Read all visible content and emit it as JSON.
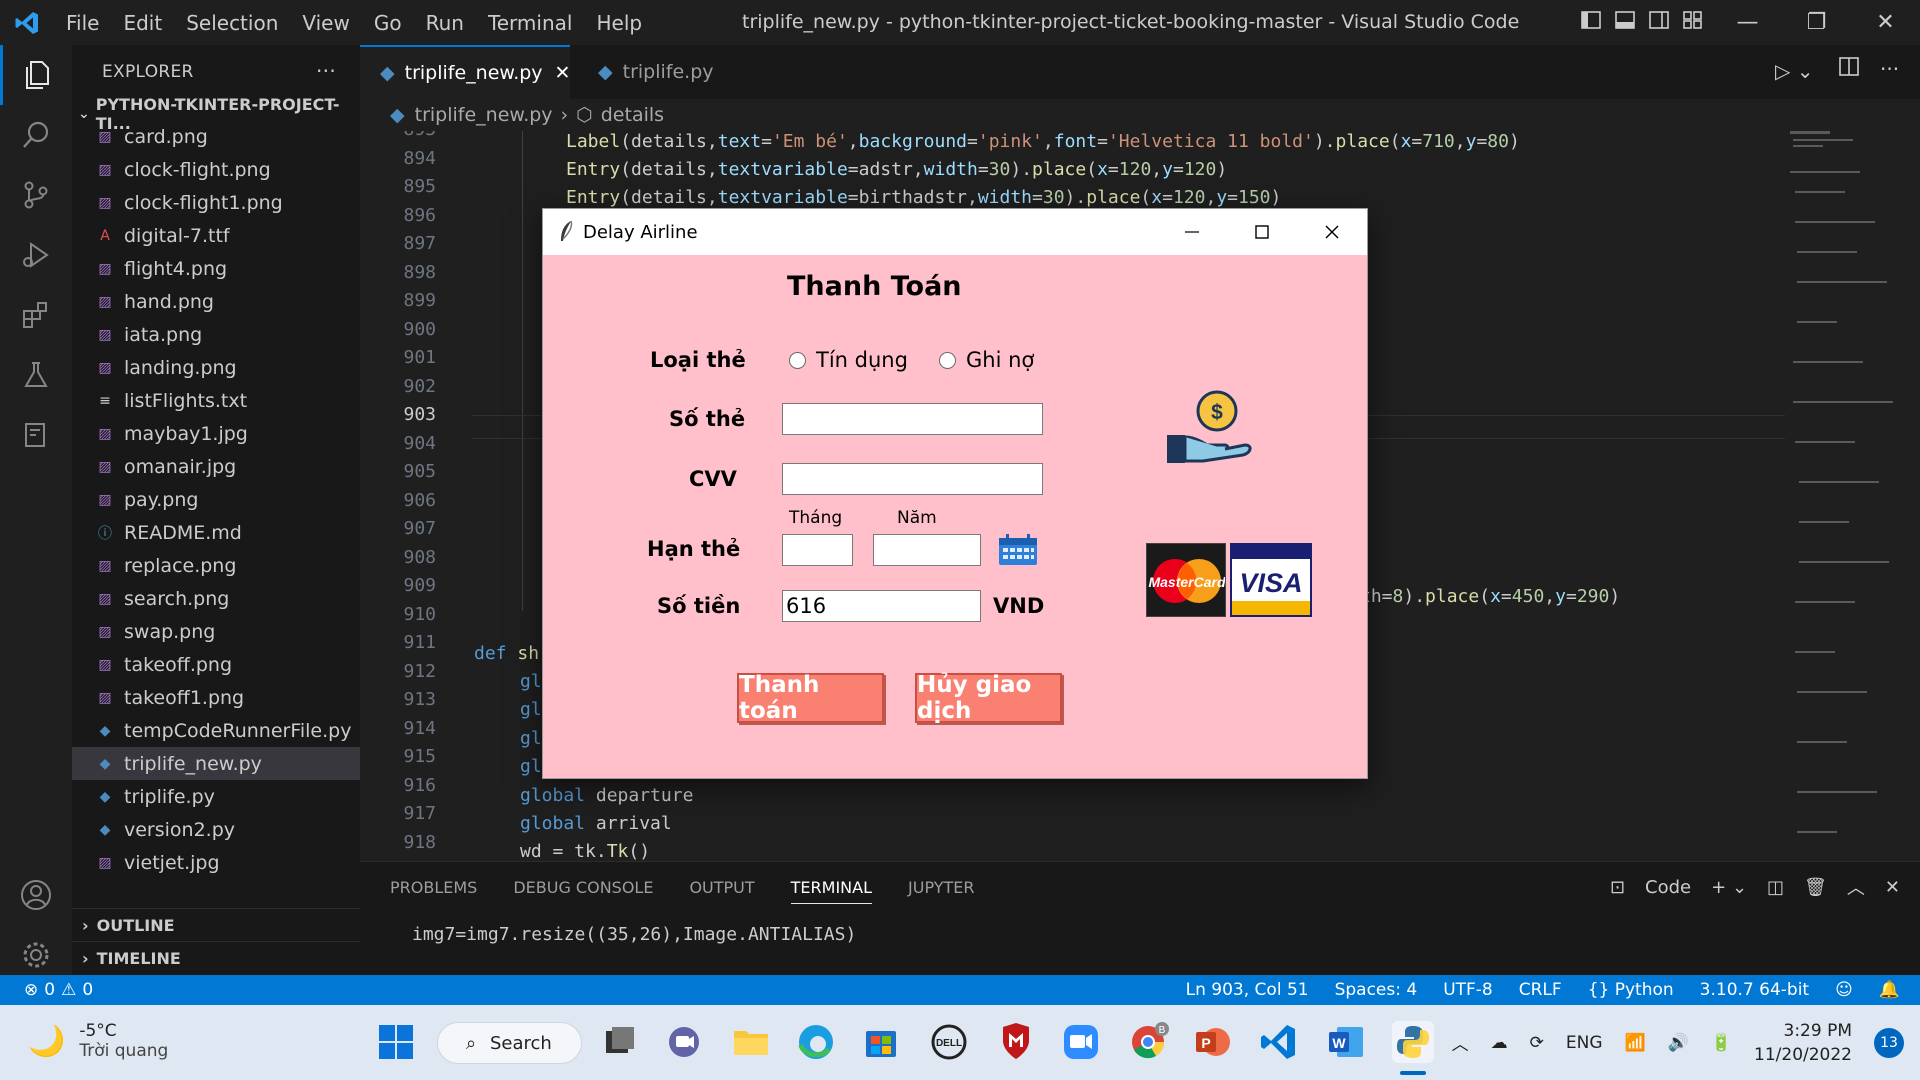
{
  "titlebar": {
    "menu": [
      "File",
      "Edit",
      "Selection",
      "View",
      "Go",
      "Run",
      "Terminal",
      "Help"
    ],
    "window_title": "triplife_new.py - python-tkinter-project-ticket-booking-master - Visual Studio Code"
  },
  "sidebar": {
    "header": "EXPLORER",
    "project": "PYTHON-TKINTER-PROJECT-TI...",
    "files": [
      {
        "name": "card.png",
        "icon": "image-file-icon"
      },
      {
        "name": "clock-flight.png",
        "icon": "image-file-icon"
      },
      {
        "name": "clock-flight1.png",
        "icon": "image-file-icon"
      },
      {
        "name": "digital-7.ttf",
        "icon": "font-file-icon"
      },
      {
        "name": "flight4.png",
        "icon": "image-file-icon"
      },
      {
        "name": "hand.png",
        "icon": "image-file-icon"
      },
      {
        "name": "iata.png",
        "icon": "image-file-icon"
      },
      {
        "name": "landing.png",
        "icon": "image-file-icon"
      },
      {
        "name": "listFlights.txt",
        "icon": "text-file-icon"
      },
      {
        "name": "maybay1.jpg",
        "icon": "image-file-icon"
      },
      {
        "name": "omanair.jpg",
        "icon": "image-file-icon"
      },
      {
        "name": "pay.png",
        "icon": "image-file-icon"
      },
      {
        "name": "README.md",
        "icon": "info-file-icon"
      },
      {
        "name": "replace.png",
        "icon": "image-file-icon"
      },
      {
        "name": "search.png",
        "icon": "image-file-icon"
      },
      {
        "name": "swap.png",
        "icon": "image-file-icon"
      },
      {
        "name": "takeoff.png",
        "icon": "image-file-icon"
      },
      {
        "name": "takeoff1.png",
        "icon": "image-file-icon"
      },
      {
        "name": "tempCodeRunnerFile.py",
        "icon": "python-file-icon"
      },
      {
        "name": "triplife_new.py",
        "icon": "python-file-icon"
      },
      {
        "name": "triplife.py",
        "icon": "python-file-icon"
      },
      {
        "name": "version2.py",
        "icon": "python-file-icon"
      },
      {
        "name": "vietjet.jpg",
        "icon": "image-file-icon"
      }
    ],
    "outline": "OUTLINE",
    "timeline": "TIMELINE"
  },
  "tabs": [
    {
      "label": "triplife_new.py",
      "active": true
    },
    {
      "label": "triplife.py",
      "active": false
    }
  ],
  "breadcrumb": {
    "file": "triplife_new.py",
    "symbol": "details"
  },
  "editor": {
    "line_numbers": [
      "893",
      "894",
      "895",
      "896",
      "897",
      "898",
      "899",
      "900",
      "901",
      "902",
      "903",
      "904",
      "905",
      "906",
      "907",
      "908",
      "909",
      "910",
      "911",
      "912",
      "913",
      "914",
      "915",
      "916",
      "917",
      "918"
    ],
    "current_line": "903",
    "lines": {
      "l893": "Label(details,text='Em bé',background='pink',font='Helvetica 11 bold').place(x=710,y=80)",
      "l894": "Entry(details,textvariable=adstr,width=30).place(x=120,y=120)",
      "l895": "Entry(details,textvariable=birthadstr,width=30).place(x=120,y=150)",
      "l909": "th=8).place(x=450,y=290)",
      "l911": "def sh",
      "l912": "gl",
      "l913": "gl",
      "l914": "gl",
      "l915": "gl",
      "l916": "global departure",
      "l917": "global arrival",
      "l918": "wd = tk.Tk()"
    }
  },
  "panel": {
    "tabs": [
      "PROBLEMS",
      "DEBUG CONSOLE",
      "OUTPUT",
      "TERMINAL",
      "JUPYTER"
    ],
    "active_tab": "TERMINAL",
    "terminal_name": "Code",
    "terminal_line": "img7=img7.resize((35,26),Image.ANTIALIAS)"
  },
  "statusbar": {
    "errors": "0",
    "warnings": "0",
    "position": "Ln 903, Col 51",
    "spaces": "Spaces: 4",
    "encoding": "UTF-8",
    "eol": "CRLF",
    "language": "Python",
    "interpreter": "3.10.7 64-bit"
  },
  "dialog": {
    "title": "Delay Airline",
    "heading": "Thanh Toán",
    "card_type_label": "Loại thẻ",
    "radio_credit": "Tín dụng",
    "radio_debit": "Ghi nợ",
    "card_number_label": "Số thẻ",
    "card_number_value": "",
    "cvv_label": "CVV",
    "cvv_value": "",
    "month_label": "Tháng",
    "year_label": "Năm",
    "expiry_label": "Hạn thẻ",
    "amount_label": "Số tiền",
    "amount_value": "616",
    "currency": "VND",
    "pay_button": "Thanh toán",
    "cancel_button": "Hủy giao dịch",
    "card_logos": {
      "mastercard": "MasterCard",
      "visa": "VISA"
    },
    "money_symbol": "$"
  },
  "taskbar": {
    "temperature": "-5°C",
    "weather": "Trời quang",
    "search": "Search",
    "language": "ENG",
    "time": "3:29 PM",
    "date": "11/20/2022",
    "notifications": "13",
    "chrome_badge": "B"
  },
  "colors": {
    "accent": "#0078d4",
    "dialog_bg": "#ffc0cb",
    "button_bg": "#fa8072",
    "statusbar": "#0078d4"
  }
}
